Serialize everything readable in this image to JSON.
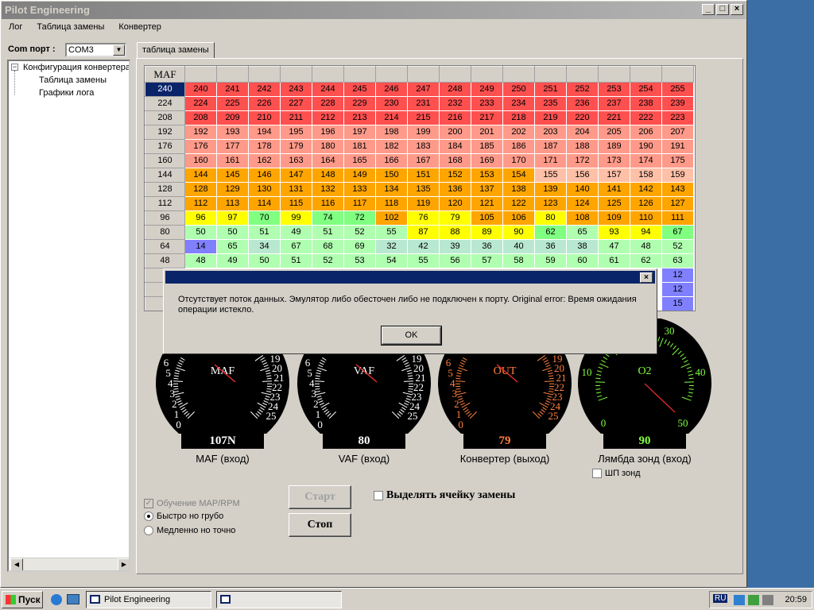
{
  "window": {
    "title": "Pilot Engineering"
  },
  "menu": [
    "Лог",
    "Таблица замены",
    "Конвертер"
  ],
  "port": {
    "label": "Com порт :",
    "value": "COM3"
  },
  "tree": {
    "root": "Конфигурация конвертера",
    "children": [
      "Таблица замены",
      "Графики лога"
    ]
  },
  "tab": "таблица замены",
  "table": {
    "corner": "MAF",
    "selected_row_label": "240",
    "rows": [
      {
        "label": "240",
        "values": [
          240,
          241,
          242,
          243,
          244,
          245,
          246,
          247,
          248,
          249,
          250,
          251,
          252,
          253,
          254,
          255
        ]
      },
      {
        "label": "224",
        "values": [
          224,
          225,
          226,
          227,
          228,
          229,
          230,
          231,
          232,
          233,
          234,
          235,
          236,
          237,
          238,
          239
        ]
      },
      {
        "label": "208",
        "values": [
          208,
          209,
          210,
          211,
          212,
          213,
          214,
          215,
          216,
          217,
          218,
          219,
          220,
          221,
          222,
          223
        ]
      },
      {
        "label": "192",
        "values": [
          192,
          193,
          194,
          195,
          196,
          197,
          198,
          199,
          200,
          201,
          202,
          203,
          204,
          205,
          206,
          207
        ]
      },
      {
        "label": "176",
        "values": [
          176,
          177,
          178,
          179,
          180,
          181,
          182,
          183,
          184,
          185,
          186,
          187,
          188,
          189,
          190,
          191
        ]
      },
      {
        "label": "160",
        "values": [
          160,
          161,
          162,
          163,
          164,
          165,
          166,
          167,
          168,
          169,
          170,
          171,
          172,
          173,
          174,
          175
        ]
      },
      {
        "label": "144",
        "values": [
          144,
          145,
          146,
          147,
          148,
          149,
          150,
          151,
          152,
          153,
          154,
          155,
          156,
          157,
          158,
          159
        ]
      },
      {
        "label": "128",
        "values": [
          128,
          129,
          130,
          131,
          132,
          133,
          134,
          135,
          136,
          137,
          138,
          139,
          140,
          141,
          142,
          143
        ]
      },
      {
        "label": "112",
        "values": [
          112,
          113,
          114,
          115,
          116,
          117,
          118,
          119,
          120,
          121,
          122,
          123,
          124,
          125,
          126,
          127
        ]
      },
      {
        "label": "96",
        "values": [
          96,
          97,
          70,
          99,
          74,
          72,
          102,
          76,
          79,
          105,
          106,
          80,
          108,
          109,
          110,
          111
        ]
      },
      {
        "label": "80",
        "values": [
          50,
          50,
          51,
          49,
          51,
          52,
          55,
          87,
          88,
          89,
          90,
          62,
          65,
          93,
          94,
          67
        ]
      },
      {
        "label": "64",
        "values": [
          14,
          65,
          34,
          67,
          68,
          69,
          32,
          42,
          39,
          36,
          40,
          36,
          38,
          47,
          48,
          52
        ]
      },
      {
        "label": "48",
        "values": [
          48,
          49,
          50,
          51,
          52,
          53,
          54,
          55,
          56,
          57,
          58,
          59,
          60,
          61,
          62,
          63
        ]
      },
      {
        "label": "",
        "values": [
          "",
          "",
          "",
          "",
          "",
          "",
          "",
          "",
          "",
          "",
          "",
          "",
          "",
          "",
          "",
          12
        ]
      },
      {
        "label": "",
        "values": [
          "",
          "",
          "",
          "",
          "",
          "",
          "",
          "",
          "",
          "",
          "",
          "",
          "",
          "",
          "",
          12
        ]
      },
      {
        "label": "",
        "values": [
          "",
          "",
          "",
          "",
          "",
          "",
          "",
          "",
          "",
          "",
          "",
          "",
          "",
          "",
          "",
          15
        ]
      }
    ],
    "colors": {
      "red": "#ff5050",
      "salmon": "#ff9a8a",
      "lightsalmon": "#ffc0a8",
      "orange": "#ffa500",
      "yellow": "#ffff00",
      "green": "#80ff80",
      "lightgreen": "#b0ffb0",
      "mint": "#b8e8d0",
      "blue": "#8080ff"
    }
  },
  "dialog": {
    "message": "Отсутствует поток данных. Эмулятор либо обесточен либо не подключен к порту. Original error: Время ожидания операции истекло.",
    "ok": "OK"
  },
  "gauges": [
    {
      "label": "MAF",
      "value": "107N",
      "caption": "MAF (вход)",
      "color": "#ffffff",
      "ticks_left": [
        "6",
        "5",
        "4",
        "3",
        "2",
        "1",
        "0"
      ],
      "ticks_right": [
        "19",
        "20",
        "21",
        "22",
        "23",
        "24",
        "25"
      ]
    },
    {
      "label": "VAF",
      "value": "80",
      "caption": "VAF (вход)",
      "color": "#ffffff",
      "ticks_left": [
        "6",
        "5",
        "4",
        "3",
        "2",
        "1",
        "0"
      ],
      "ticks_right": [
        "19",
        "20",
        "21",
        "22",
        "23",
        "24",
        "25"
      ]
    },
    {
      "label": "OUT",
      "value": "79",
      "caption": "Конвертер (выход)",
      "color": "#ff8040",
      "ticks_left": [
        "6",
        "5",
        "4",
        "3",
        "2",
        "1",
        "0"
      ],
      "ticks_right": [
        "19",
        "20",
        "21",
        "22",
        "23",
        "24",
        "25"
      ]
    },
    {
      "label": "O2",
      "value": "90",
      "caption": "Лямбда зонд (вход)",
      "color": "#80ff40",
      "ticks": [
        "30",
        "40",
        "10",
        "0",
        "50"
      ]
    }
  ],
  "checkbox_wb": {
    "label": "ШП  зонд",
    "checked": false
  },
  "learn": {
    "label": "Обучение MAP/RPM",
    "checked": true
  },
  "radio_fast": {
    "label": "Быстро но грубо",
    "selected": true
  },
  "radio_slow": {
    "label": "Медленно но точно",
    "selected": false
  },
  "highlight": {
    "label": "Выделять ячейку замены",
    "checked": false
  },
  "buttons": {
    "start": "Старт",
    "stop": "Стоп"
  },
  "taskbar": {
    "start": "Пуск",
    "task": "Pilot Engineering",
    "lang": "RU",
    "clock": "20:59"
  }
}
